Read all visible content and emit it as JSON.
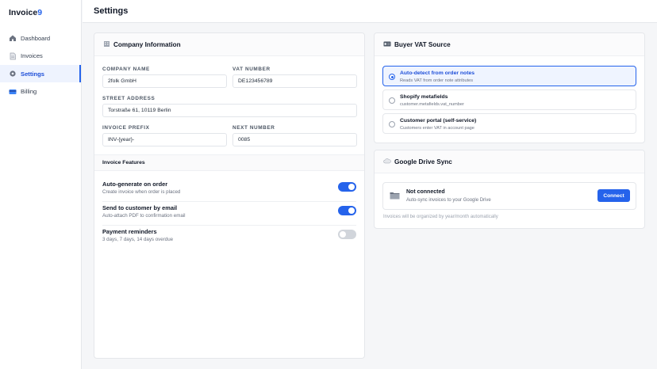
{
  "app": {
    "brand_name": "Invoice",
    "brand_accent": "9",
    "accent_color": "#2563eb"
  },
  "sidebar": {
    "items": [
      {
        "label": "Dashboard",
        "icon": "dashboard-icon"
      },
      {
        "label": "Invoices",
        "icon": "document-icon"
      },
      {
        "label": "Settings",
        "icon": "gear-icon",
        "active": true
      },
      {
        "label": "Billing",
        "icon": "credit-card-icon"
      }
    ]
  },
  "header": {
    "title": "Settings"
  },
  "company": {
    "title": "Company Information",
    "fields": {
      "company_name": {
        "label": "COMPANY NAME",
        "value": "2folk GmbH"
      },
      "vat_number": {
        "label": "VAT NUMBER",
        "value": "DE123456789"
      },
      "street_address": {
        "label": "STREET ADDRESS",
        "value": "Torstraße 61, 10119 Berlin"
      },
      "invoice_prefix": {
        "label": "INVOICE PREFIX",
        "value": "INV-{year}-"
      },
      "next_number": {
        "label": "NEXT NUMBER",
        "value": "0085"
      }
    },
    "features_title": "Invoice Features",
    "features": [
      {
        "title": "Auto-generate on order",
        "desc": "Create invoice when order is placed",
        "enabled": true
      },
      {
        "title": "Send to customer by email",
        "desc": "Auto-attach PDF to confirmation email",
        "enabled": true
      },
      {
        "title": "Payment reminders",
        "desc": "3 days, 7 days, 14 days overdue",
        "enabled": false
      }
    ]
  },
  "vat_source": {
    "title": "Buyer VAT Source",
    "options": [
      {
        "title": "Auto-detect from order notes",
        "desc": "Reads VAT from order note attributes",
        "selected": true
      },
      {
        "title": "Shopify metafields",
        "desc": "customer.metafields.vat_number",
        "selected": false
      },
      {
        "title": "Customer portal (self-service)",
        "desc": "Customers enter VAT in account page",
        "selected": false
      }
    ]
  },
  "drive": {
    "title": "Google Drive Sync",
    "status": "Not connected",
    "status_desc": "Auto-sync invoices to your Google Drive",
    "connect_label": "Connect",
    "note": "Invoices will be organized by year/month automatically"
  }
}
